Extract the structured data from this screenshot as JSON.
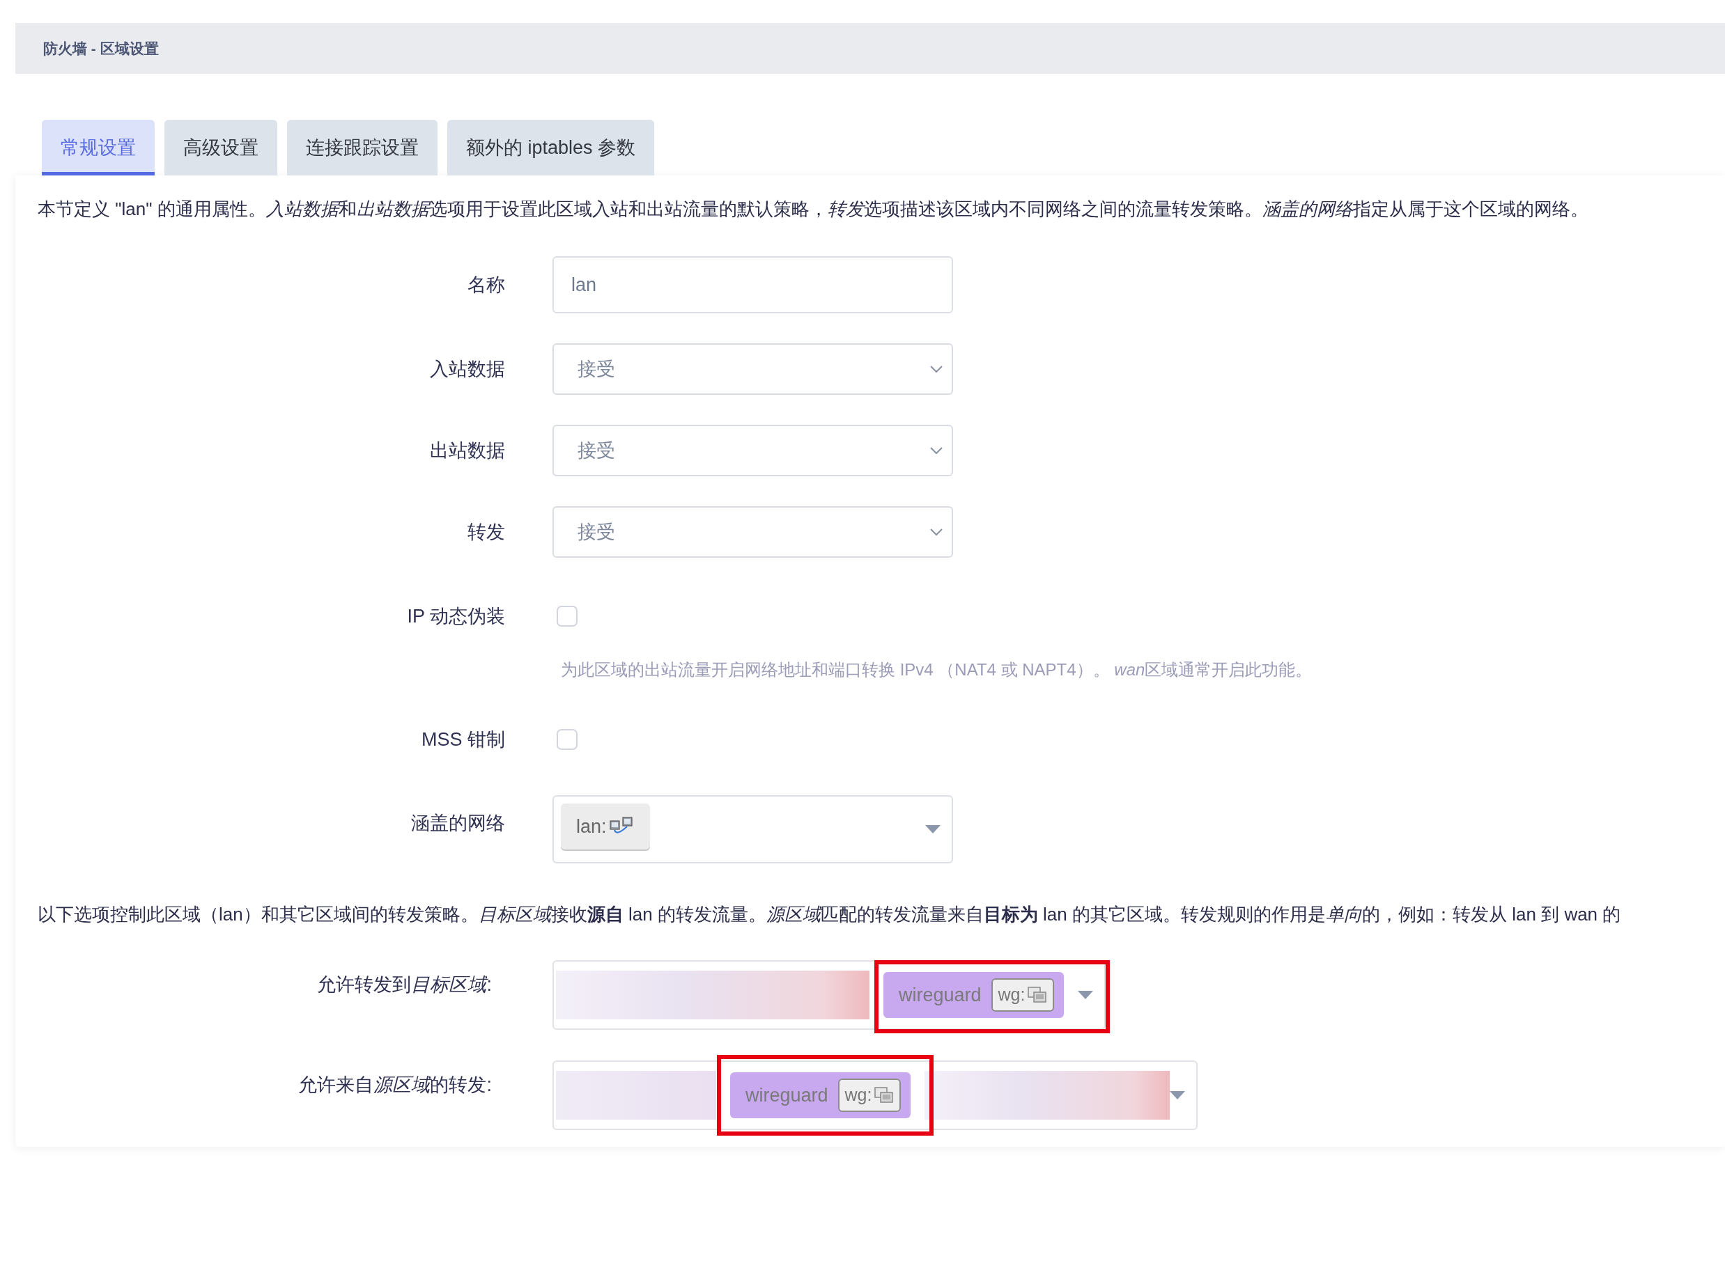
{
  "page_title": "防火墙 - 区域设置",
  "tabs": [
    {
      "label": "常规设置",
      "selected": true
    },
    {
      "label": "高级设置",
      "selected": false
    },
    {
      "label": "连接跟踪设置",
      "selected": false
    },
    {
      "label": "额外的 iptables 参数",
      "selected": false
    }
  ],
  "description": [
    {
      "text": "本节定义 \"lan\" 的通用属性。",
      "italic": false
    },
    {
      "text": "入站数据",
      "italic": true
    },
    {
      "text": "和",
      "italic": false
    },
    {
      "text": "出站数据",
      "italic": true
    },
    {
      "text": "选项用于设置此区域入站和出站流量的默认策略，",
      "italic": false
    },
    {
      "text": "转发",
      "italic": true
    },
    {
      "text": "选项描述该区域内不同网络之间的流量转发策略。",
      "italic": false
    },
    {
      "text": "涵盖的网络",
      "italic": true
    },
    {
      "text": "指定从属于这个区域的网络。",
      "italic": false
    }
  ],
  "fields": [
    {
      "kind": "text",
      "label": "名称",
      "value": "lan"
    },
    {
      "kind": "select",
      "label": "入站数据",
      "value": "接受"
    },
    {
      "kind": "select",
      "label": "出站数据",
      "value": "接受"
    },
    {
      "kind": "select",
      "label": "转发",
      "value": "接受"
    },
    {
      "kind": "checkbox",
      "label": "IP 动态伪装",
      "checked": false,
      "hint": [
        {
          "text": "为此区域的出站流量开启网络地址和端口转换 IPv4 （NAT4 或 NAPT4）。 ",
          "italic": false
        },
        {
          "text": "wan",
          "italic": true
        },
        {
          "text": "区域通常开启此功能。",
          "italic": false
        }
      ]
    },
    {
      "kind": "checkbox",
      "label": "MSS 钳制",
      "checked": false
    },
    {
      "kind": "network_picker",
      "label": "涵盖的网络",
      "networks": [
        {
          "label": "lan:"
        }
      ]
    }
  ],
  "forwarding_description": [
    {
      "text": "以下选项控制此区域（lan）和其它区域间的转发策略。",
      "italic": false
    },
    {
      "text": "目标区域",
      "italic": true
    },
    {
      "text": "接收**源自** lan 的转发流量。",
      "italic": false
    },
    {
      "text": "源区域",
      "italic": true
    },
    {
      "text": "匹配的转发流量来自**目标为** lan 的其它区域。转发规则的作用是",
      "italic": false
    },
    {
      "text": "单向",
      "italic": true
    },
    {
      "text": "的，例如：转发从 lan 到 wan 的",
      "italic": false
    }
  ],
  "forwarding_fields": [
    {
      "label": [
        {
          "text": "允许转发到",
          "italic": false
        },
        {
          "text": "目标区域",
          "italic": true
        },
        {
          "text": ":",
          "italic": false
        }
      ],
      "zones": [
        {
          "kind": "blurred"
        },
        {
          "kind": "zone",
          "name": "wireguard",
          "network": "wg:",
          "highlighted": true
        }
      ]
    },
    {
      "label": [
        {
          "text": "允许来自",
          "italic": false
        },
        {
          "text": "源区域",
          "italic": true
        },
        {
          "text": "的转发:",
          "italic": false
        }
      ],
      "zones": [
        {
          "kind": "blurred"
        },
        {
          "kind": "zone",
          "name": "wireguard",
          "network": "wg:",
          "highlighted": true
        },
        {
          "kind": "blurred"
        }
      ]
    }
  ]
}
